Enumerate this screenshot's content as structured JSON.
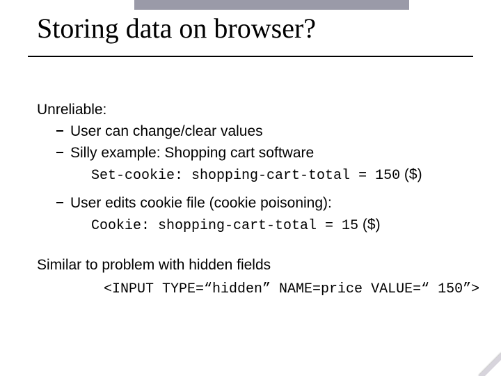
{
  "title": "Storing data on browser?",
  "body": {
    "p1": "Unreliable:",
    "b1": "User can change/clear values",
    "b2": "Silly example: Shopping cart software",
    "code1": "Set-cookie: shopping-cart-total = 150",
    "d1": "  ($)",
    "b3": "User edits cookie file  (cookie poisoning):",
    "code2_a": "Cookie:",
    "code2_b": "   shopping-cart-total = 15",
    "d2": "    ($)",
    "p2": "Similar to problem with hidden fields",
    "code3": "<INPUT TYPE=“hidden” NAME=price VALUE=“ 150”>"
  }
}
